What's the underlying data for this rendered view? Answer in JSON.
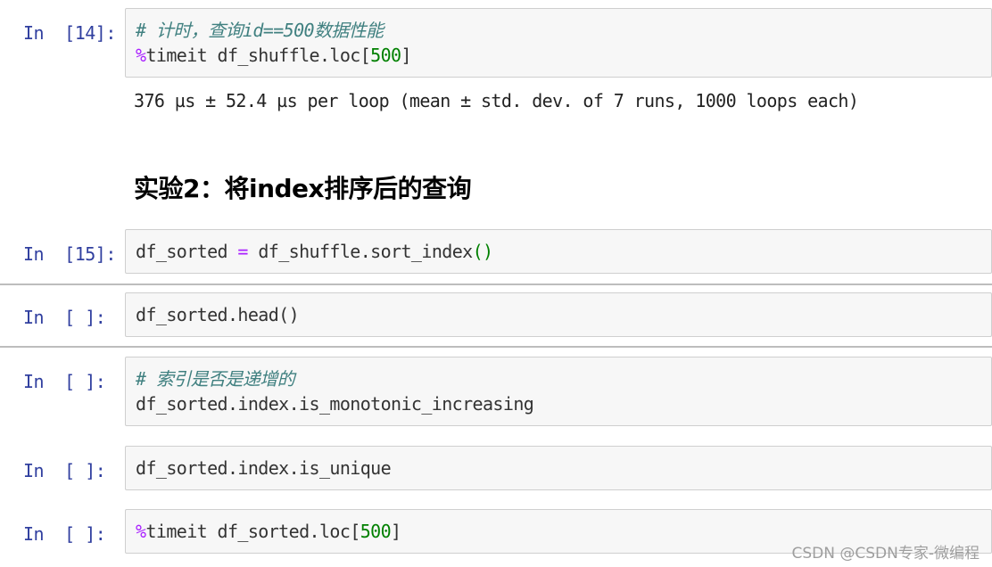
{
  "cells": [
    {
      "prompt": "In  [14]:",
      "lines": [
        {
          "comment": "# 计时，查询id==500数据性能"
        },
        {
          "magic": "%",
          "text": "timeit df_shuffle.loc[",
          "num": "500",
          "tail": "]"
        }
      ],
      "output": "376 µs ± 52.4 µs per loop (mean ± std. dev. of 7 runs, 1000 loops each)"
    },
    {
      "prompt": "In  [15]:",
      "lines": [
        {
          "text": "df_sorted ",
          "op": "=",
          "text2": " df_shuffle.sort_index",
          "paren": "()"
        }
      ]
    },
    {
      "prompt": "In  [ ]:",
      "lines": [
        {
          "text": "df_sorted.head()"
        }
      ]
    },
    {
      "prompt": "In  [ ]:",
      "lines": [
        {
          "comment": "# 索引是否是递增的"
        },
        {
          "text": "df_sorted.index.is_monotonic_increasing"
        }
      ]
    },
    {
      "prompt": "In  [ ]:",
      "lines": [
        {
          "text": "df_sorted.index.is_unique"
        }
      ]
    },
    {
      "prompt": "In  [ ]:",
      "lines": [
        {
          "magic": "%",
          "text": "timeit df_sorted.loc[",
          "num": "500",
          "tail": "]"
        }
      ]
    }
  ],
  "markdown": {
    "heading": "实验2：将index排序后的查询"
  },
  "watermark": "CSDN @CSDN专家-微编程"
}
